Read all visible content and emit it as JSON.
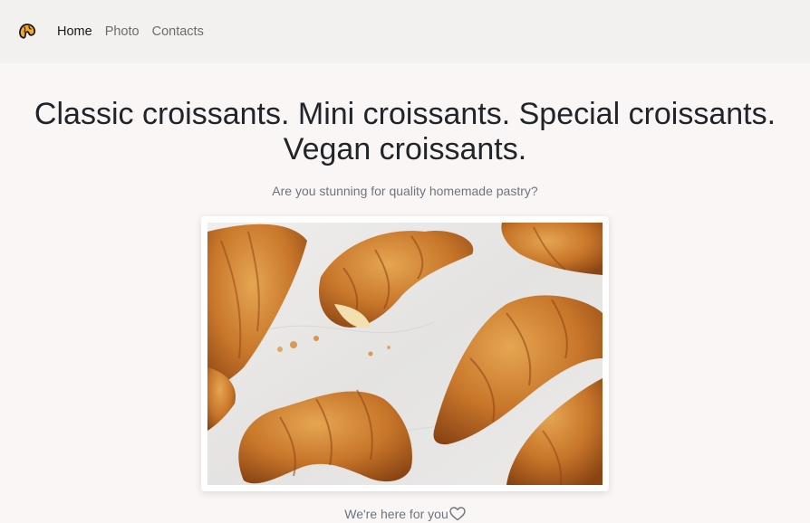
{
  "nav": {
    "logo_icon": "croissant-logo-icon",
    "items": [
      {
        "label": "Home",
        "active": true
      },
      {
        "label": "Photo",
        "active": false
      },
      {
        "label": "Contacts",
        "active": false
      }
    ]
  },
  "hero": {
    "title": "Classic croissants. Mini croissants. Special croissants. Vegan croissants.",
    "subtitle": "Are you stunning for quality homemade pastry?"
  },
  "photo": {
    "description_icon": "croissants-photo"
  },
  "footer": {
    "text": "We're here for you",
    "icon": "heart-outline-icon"
  },
  "colors": {
    "nav_bg": "#f3f0f0",
    "page_bg": "#faf6f5",
    "logo_accent": "#f2a82a"
  }
}
